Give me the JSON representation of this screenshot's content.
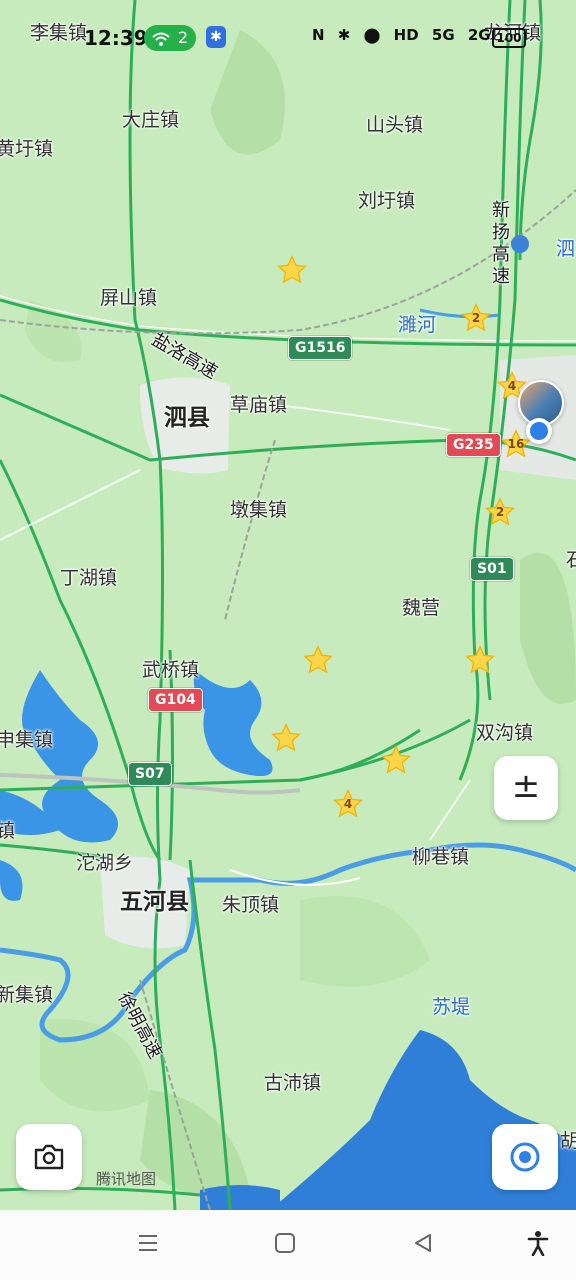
{
  "status_bar": {
    "time": "12:39",
    "hotspot_count": "2",
    "bluetooth_badge": "✱",
    "indicators": [
      "N",
      "✱",
      "⬤",
      "HD",
      "5G",
      "2G"
    ],
    "battery": "100",
    "accent": "#25b04a"
  },
  "map": {
    "towns": {
      "lijizhen": "李集镇",
      "longhezhen": "龙河镇",
      "dazhuangzhen": "大庄镇",
      "shantouzhen": "山头镇",
      "huangyuzhen": "黄圩镇",
      "liuxuzhen": "刘圩镇",
      "pingshanzhen": "屏山镇",
      "caomiaozhen": "草庙镇",
      "dunjizhen": "墩集镇",
      "dinghuzhen": "丁湖镇",
      "weiying": "魏营",
      "wuqiaozhen": "武桥镇",
      "shuanggouzhen": "双沟镇",
      "shenjizhen": "申集镇",
      "tuohuxiang": "沱湖乡",
      "liuxiangzhen": "柳巷镇",
      "zhudingzhen": "朱顶镇",
      "xinjizhen": "新集镇",
      "guyuzhen": "古沛镇",
      "hu": "胡",
      "shi": "石",
      "zhen": "镇"
    },
    "counties": {
      "sixian": "泗县",
      "wuhexian": "五河县"
    },
    "water": {
      "weihe": "濉河",
      "sudi": "苏堤"
    },
    "roads": {
      "yanluo": "盐洛高速",
      "xinyang": "新扬高速",
      "xuming": "徐明高速"
    },
    "shields": {
      "g1516": "G1516",
      "g235": "G235",
      "s01": "S01",
      "g104": "G104",
      "s07": "S07"
    },
    "poi_right": "泗",
    "star_counts": [
      "2",
      "4",
      "16",
      "2",
      "4"
    ],
    "attribution": "腾讯地图"
  },
  "controls": {
    "zoom_symbol": "±",
    "camera_icon": "camera-icon",
    "locate_icon": "locate-icon"
  },
  "nav": {
    "menu_icon": "menu-icon",
    "home_icon": "home-icon",
    "back_icon": "back-icon",
    "accessibility_icon": "accessibility-icon"
  }
}
